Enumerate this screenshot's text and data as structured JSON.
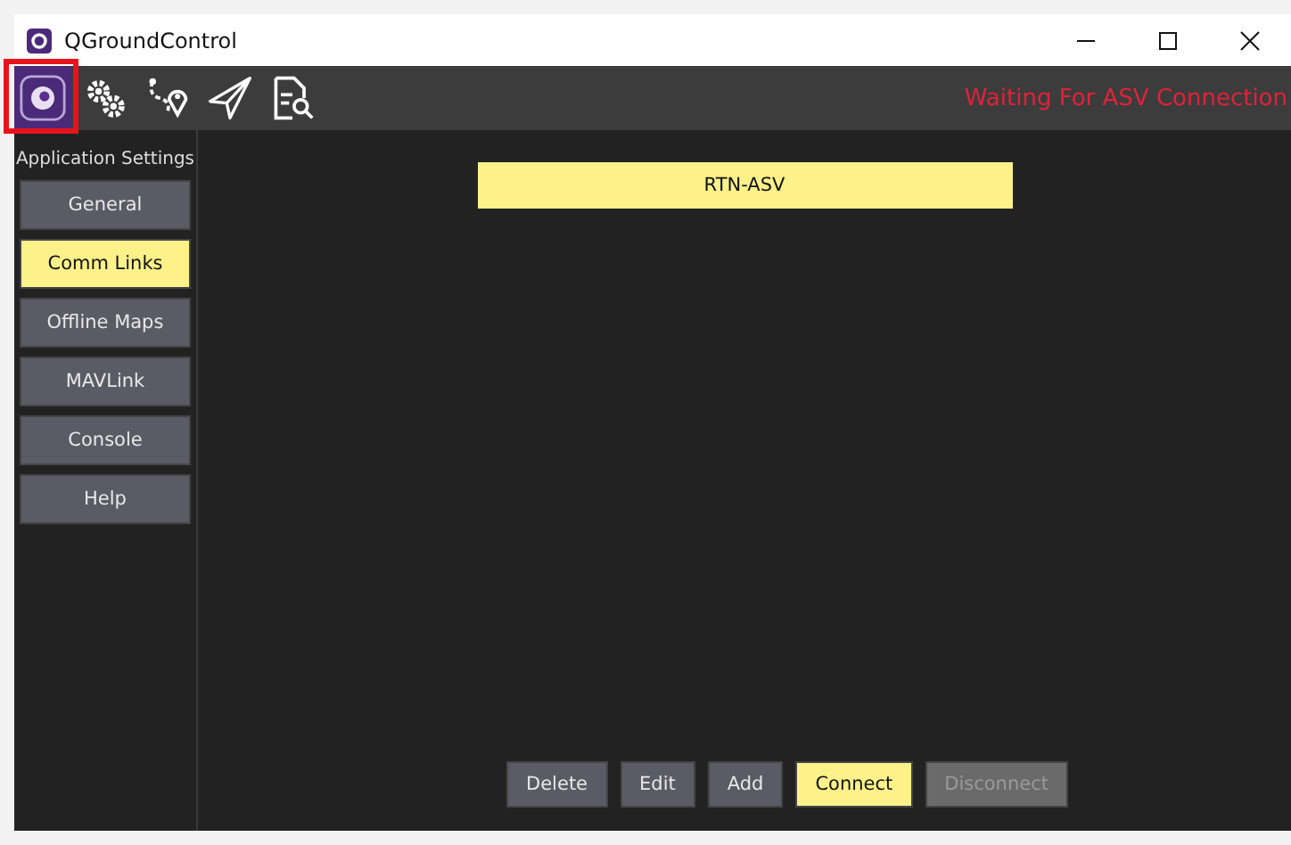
{
  "window": {
    "title": "QGroundControl"
  },
  "toolbar": {
    "tools": [
      {
        "kind": "app",
        "selected": true
      },
      {
        "kind": "gears",
        "selected": false
      },
      {
        "kind": "plan",
        "selected": false
      },
      {
        "kind": "fly",
        "selected": false
      },
      {
        "kind": "analyze",
        "selected": false
      }
    ],
    "status": "Waiting For ASV Connection"
  },
  "sidebar": {
    "heading": "Application Settings",
    "items": [
      {
        "label": "General",
        "selected": false
      },
      {
        "label": "Comm Links",
        "selected": true
      },
      {
        "label": "Offline Maps",
        "selected": false
      },
      {
        "label": "MAVLink",
        "selected": false
      },
      {
        "label": "Console",
        "selected": false
      },
      {
        "label": "Help",
        "selected": false
      }
    ]
  },
  "links": [
    {
      "label": "RTN-ASV",
      "selected": true
    }
  ],
  "buttons": [
    {
      "label": "Delete",
      "primary": false,
      "disabled": false
    },
    {
      "label": "Edit",
      "primary": false,
      "disabled": false
    },
    {
      "label": "Add",
      "primary": false,
      "disabled": false
    },
    {
      "label": "Connect",
      "primary": true,
      "disabled": false
    },
    {
      "label": "Disconnect",
      "primary": false,
      "disabled": true
    }
  ]
}
